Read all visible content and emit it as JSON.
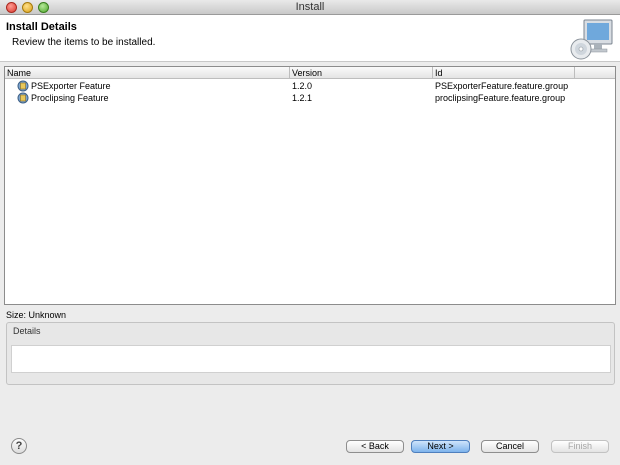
{
  "window": {
    "title": "Install"
  },
  "header": {
    "title": "Install Details",
    "description": "Review the items to be installed.",
    "icon": "install-monitor-cd-icon"
  },
  "table": {
    "columns": [
      "Name",
      "Version",
      "Id"
    ],
    "rows": [
      {
        "name": "PSExporter Feature",
        "version": "1.2.0",
        "id": "PSExporterFeature.feature.group",
        "icon": "feature-plugin-icon"
      },
      {
        "name": "Proclipsing Feature",
        "version": "1.2.1",
        "id": "proclipsingFeature.feature.group",
        "icon": "feature-plugin-icon"
      }
    ]
  },
  "size": {
    "label": "Size: Unknown"
  },
  "details": {
    "label": "Details",
    "text": ""
  },
  "buttons": {
    "help": "?",
    "back": "< Back",
    "next": "Next >",
    "cancel": "Cancel",
    "finish": "Finish"
  },
  "colors": {
    "accent": "#7db3ec",
    "disabled_text": "#a7a7a7"
  }
}
